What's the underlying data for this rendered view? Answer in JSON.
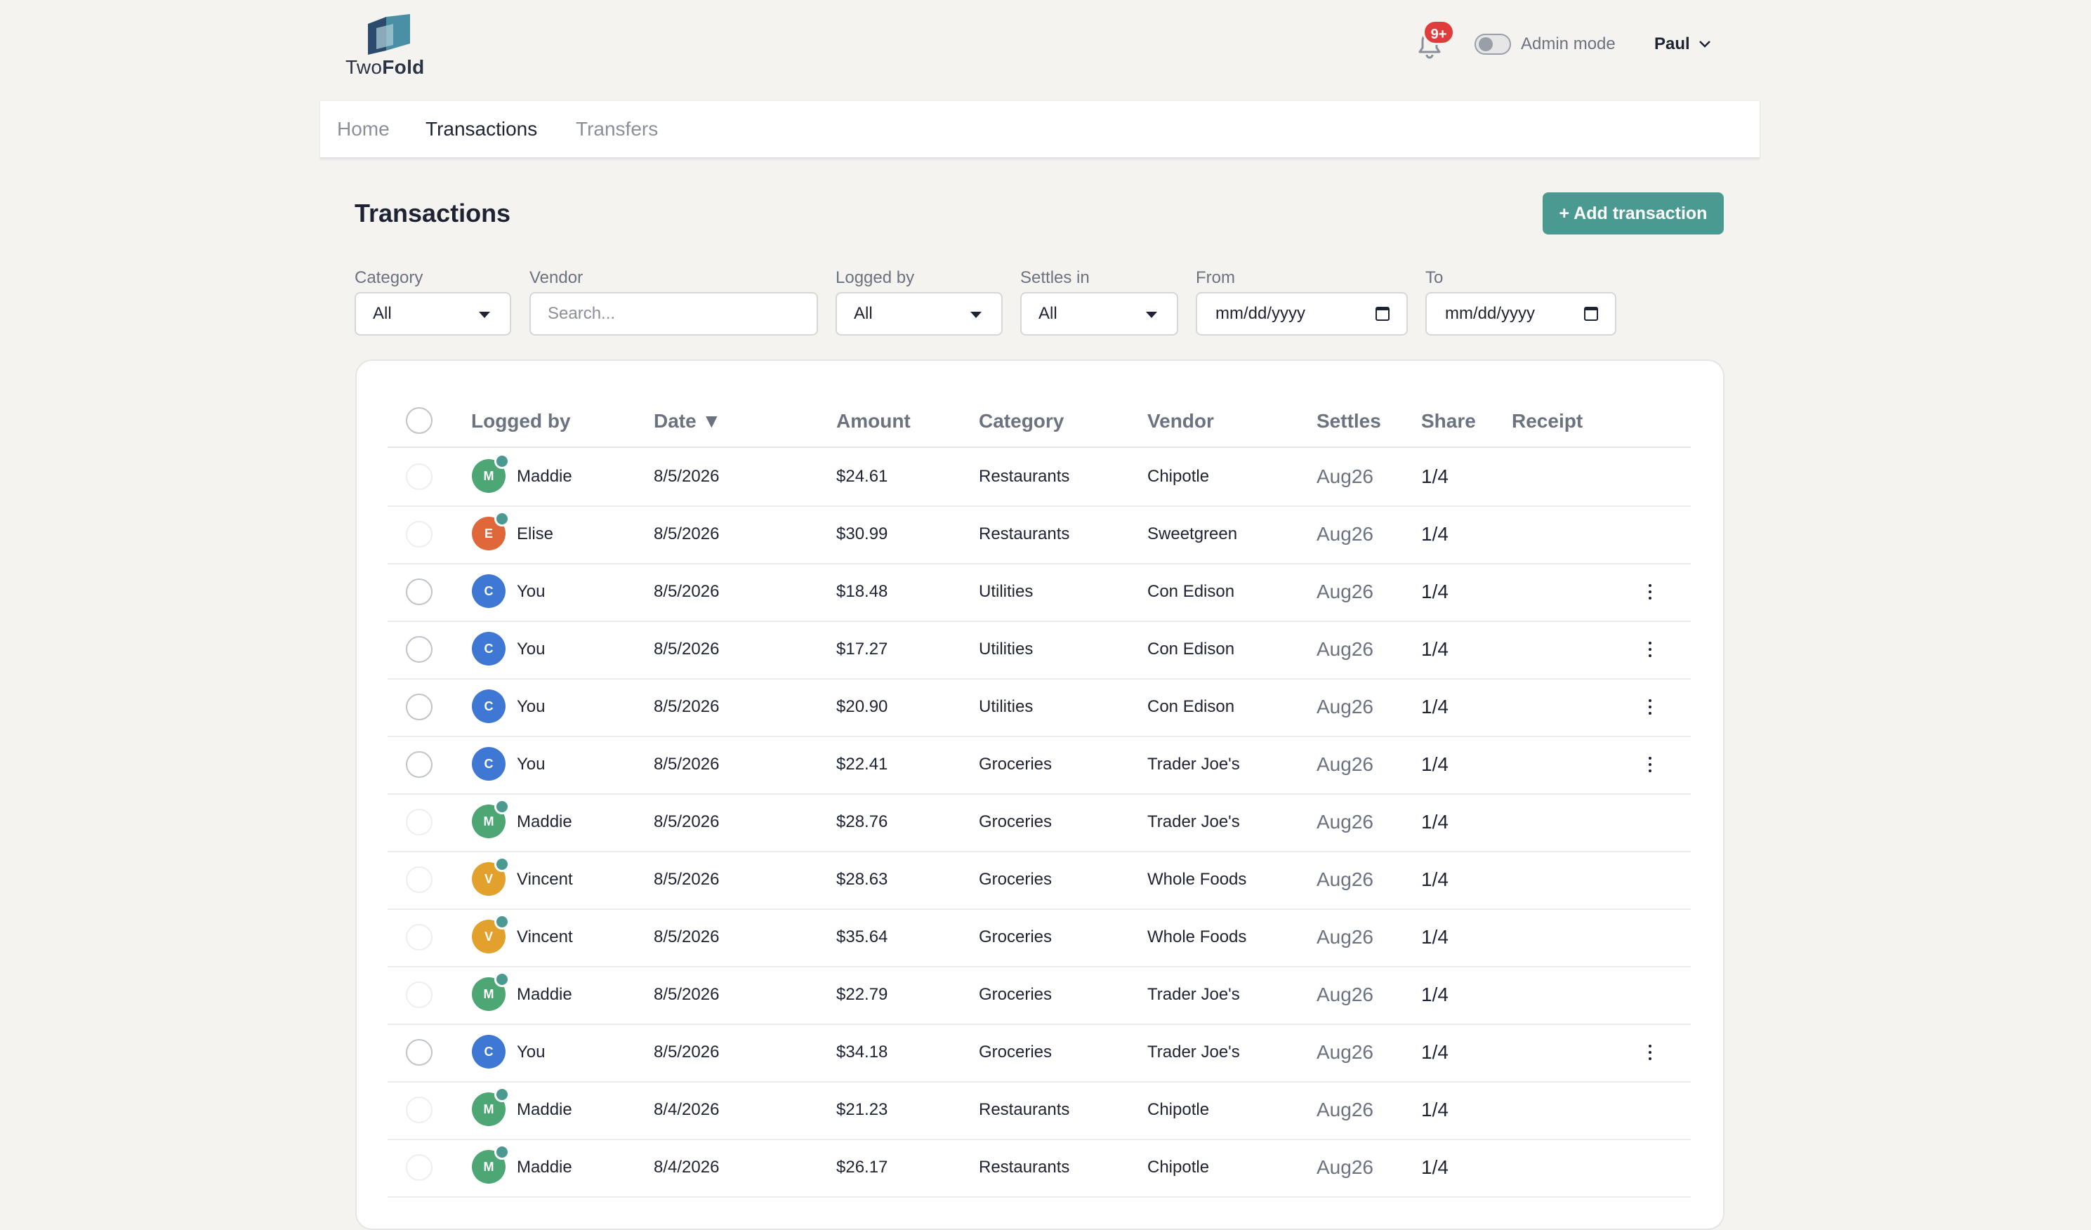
{
  "app": {
    "logo_prefix": "Two",
    "logo_suffix": "Fold"
  },
  "header": {
    "notifications_badge": "9+",
    "admin_mode_label": "Admin mode",
    "admin_mode_on": false,
    "user_name": "Paul"
  },
  "nav": {
    "tabs": [
      {
        "label": "Home",
        "active": false
      },
      {
        "label": "Transactions",
        "active": true
      },
      {
        "label": "Transfers",
        "active": false
      }
    ]
  },
  "page": {
    "title": "Transactions",
    "add_button_label": "+ Add transaction"
  },
  "filters": {
    "category": {
      "label": "Category",
      "value": "All"
    },
    "vendor": {
      "label": "Vendor",
      "placeholder": "Search..."
    },
    "logged_by": {
      "label": "Logged by",
      "value": "All"
    },
    "settles_in": {
      "label": "Settles in",
      "value": "All"
    },
    "from": {
      "label": "From",
      "value": "mm/dd/yyyy"
    },
    "to": {
      "label": "To",
      "value": "mm/dd/yyyy"
    }
  },
  "table": {
    "columns": {
      "logged_by": "Logged by",
      "date": "Date ▼",
      "amount": "Amount",
      "category": "Category",
      "vendor": "Vendor",
      "settles": "Settles",
      "share": "Share",
      "receipt": "Receipt"
    },
    "rows": [
      {
        "initial": "M",
        "color": "#4da774",
        "name": "Maddie",
        "date": "8/5/2026",
        "amount": "$24.61",
        "category": "Restaurants",
        "vendor": "Chipotle",
        "settles": "Aug26",
        "share": "1/4",
        "own": false
      },
      {
        "initial": "E",
        "color": "#e0673a",
        "name": "Elise",
        "date": "8/5/2026",
        "amount": "$30.99",
        "category": "Restaurants",
        "vendor": "Sweetgreen",
        "settles": "Aug26",
        "share": "1/4",
        "own": false
      },
      {
        "initial": "C",
        "color": "#3f78d4",
        "name": "You",
        "date": "8/5/2026",
        "amount": "$18.48",
        "category": "Utilities",
        "vendor": "Con Edison",
        "settles": "Aug26",
        "share": "1/4",
        "own": true
      },
      {
        "initial": "C",
        "color": "#3f78d4",
        "name": "You",
        "date": "8/5/2026",
        "amount": "$17.27",
        "category": "Utilities",
        "vendor": "Con Edison",
        "settles": "Aug26",
        "share": "1/4",
        "own": true
      },
      {
        "initial": "C",
        "color": "#3f78d4",
        "name": "You",
        "date": "8/5/2026",
        "amount": "$20.90",
        "category": "Utilities",
        "vendor": "Con Edison",
        "settles": "Aug26",
        "share": "1/4",
        "own": true
      },
      {
        "initial": "C",
        "color": "#3f78d4",
        "name": "You",
        "date": "8/5/2026",
        "amount": "$22.41",
        "category": "Groceries",
        "vendor": "Trader Joe's",
        "settles": "Aug26",
        "share": "1/4",
        "own": true
      },
      {
        "initial": "M",
        "color": "#4da774",
        "name": "Maddie",
        "date": "8/5/2026",
        "amount": "$28.76",
        "category": "Groceries",
        "vendor": "Trader Joe's",
        "settles": "Aug26",
        "share": "1/4",
        "own": false
      },
      {
        "initial": "V",
        "color": "#e2a12c",
        "name": "Vincent",
        "date": "8/5/2026",
        "amount": "$28.63",
        "category": "Groceries",
        "vendor": "Whole Foods",
        "settles": "Aug26",
        "share": "1/4",
        "own": false
      },
      {
        "initial": "V",
        "color": "#e2a12c",
        "name": "Vincent",
        "date": "8/5/2026",
        "amount": "$35.64",
        "category": "Groceries",
        "vendor": "Whole Foods",
        "settles": "Aug26",
        "share": "1/4",
        "own": false
      },
      {
        "initial": "M",
        "color": "#4da774",
        "name": "Maddie",
        "date": "8/5/2026",
        "amount": "$22.79",
        "category": "Groceries",
        "vendor": "Trader Joe's",
        "settles": "Aug26",
        "share": "1/4",
        "own": false
      },
      {
        "initial": "C",
        "color": "#3f78d4",
        "name": "You",
        "date": "8/5/2026",
        "amount": "$34.18",
        "category": "Groceries",
        "vendor": "Trader Joe's",
        "settles": "Aug26",
        "share": "1/4",
        "own": true
      },
      {
        "initial": "M",
        "color": "#4da774",
        "name": "Maddie",
        "date": "8/4/2026",
        "amount": "$21.23",
        "category": "Restaurants",
        "vendor": "Chipotle",
        "settles": "Aug26",
        "share": "1/4",
        "own": false
      },
      {
        "initial": "M",
        "color": "#4da774",
        "name": "Maddie",
        "date": "8/4/2026",
        "amount": "$26.17",
        "category": "Restaurants",
        "vendor": "Chipotle",
        "settles": "Aug26",
        "share": "1/4",
        "own": false
      }
    ]
  }
}
